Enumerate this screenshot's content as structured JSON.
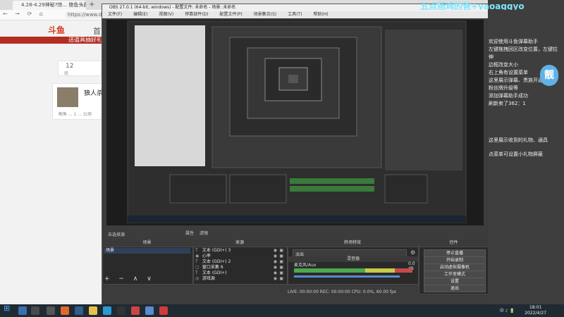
{
  "browser": {
    "tab_title": "4.28-4.29神秘?惊... 鲍鱼头面包 ...",
    "url": "https://www.douyu",
    "nav_icons": "← → ⟳ ⌂",
    "site_logo": "斗鱼",
    "site_nav": "首页",
    "banner_text": "送道具抽好礼",
    "card_num": "12",
    "card_unit": "级",
    "card_title": "狼人杀",
    "card_sub": "鲍鱼 ... 1 ... 公测"
  },
  "obs": {
    "title": "OBS 27.0.1 (64-bit, windows) - 配置文件: 未命名 - 场景: 未命名",
    "menu": [
      "文件(F)",
      "编辑(E)",
      "视图(V)",
      "停靠部件(D)",
      "配置文件(P)",
      "场景集合(S)",
      "工具(T)",
      "帮助(H)"
    ],
    "no_source": "未选择源",
    "props_btn": "属性",
    "filter_btn": "滤镜",
    "scenes_header": "场景",
    "scene_item": "场景",
    "sources_header": "来源",
    "sources": [
      {
        "icon": "T",
        "name": "文本 (GDI+) 3"
      },
      {
        "icon": "◉",
        "name": "心率"
      },
      {
        "icon": "T",
        "name": "文本 (GDI+) 2"
      },
      {
        "icon": "▢",
        "name": "窗口采集 6"
      },
      {
        "icon": "T",
        "name": "文本 (GDI+)"
      },
      {
        "icon": "◎",
        "name": "游戏源"
      }
    ],
    "dock_tools": "+ − ∧ ∨",
    "mixer_header": "转场特效",
    "mixer_sub_header": "混音器",
    "transition": "淡出",
    "mixer_track": "麦克风/Aux",
    "mixer_db": "0.0 dB",
    "controls_header": "控件",
    "controls": [
      "停止直播",
      "开始录制",
      "启动虚拟摄像机",
      "工作室模式",
      "设置",
      "退出"
    ],
    "status": "LIVE: 00:00:00    REC: 00:00:00    CPU: 0.0%, 60.00 fps"
  },
  "overlay": {
    "lines": [
      "欢迎使用斗鱼弹幕助手",
      "左键拖拽回区改变位置，左键拉伸",
      "边框改变大小",
      "右上角有设置菜单",
      "这里展示弹幕、贵族开通/续费、",
      "粉丝牌升级等",
      "添加弹幕助手成功",
      "刷新卖了362：1"
    ],
    "line2": "这里展示收到的礼物、通具",
    "line3": "点菜单可设置小礼物屏蔽",
    "watermark": "五点扬鸡的爸+yaoaggyo",
    "badge": "靓"
  },
  "taskbar": {
    "start": "⊞",
    "tray": "中 ♪ 🔋",
    "time": "18:01",
    "date": "2022/4/27"
  },
  "colors": {
    "obs_bg": "#3c3c3c",
    "scene_selected": "#30405a",
    "meter_green": "#4ea84e",
    "watermark": "#7de6ff",
    "taskbar": "#1f2a33"
  }
}
